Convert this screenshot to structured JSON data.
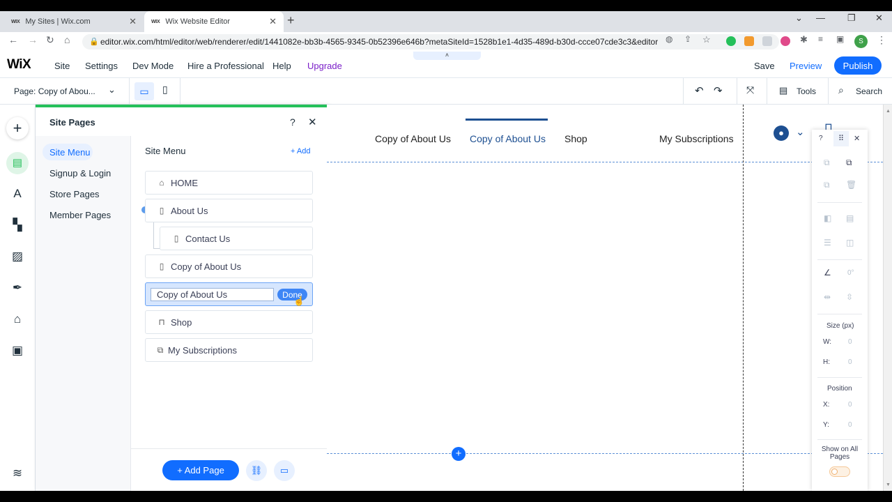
{
  "browser": {
    "tabs": [
      {
        "favicon": "WIX",
        "title": "My Sites | Wix.com"
      },
      {
        "favicon": "WIX",
        "title": "Wix Website Editor"
      }
    ],
    "url": "editor.wix.com/html/editor/web/renderer/edit/1441082e-bb3b-4565-9345-0b52396e646b?metaSiteId=1528b1e1-4d35-489d-b30d-ccce07cde3c3&editor...",
    "profile_initial": "S"
  },
  "topbar": {
    "logo": "WiX",
    "menu": [
      "Site",
      "Settings",
      "Dev Mode",
      "Hire a Professional",
      "Help",
      "Upgrade"
    ],
    "save": "Save",
    "preview": "Preview",
    "publish": "Publish",
    "collapse": "˄"
  },
  "toolbar": {
    "page_selector": "Page: Copy of Abou...",
    "tools": "Tools",
    "search": "Search"
  },
  "panel": {
    "title": "Site Pages",
    "help": "?",
    "categories": [
      "Site Menu",
      "Signup & Login",
      "Store Pages",
      "Member Pages"
    ],
    "section_title": "Site Menu",
    "add_label": "+ Add",
    "pages": [
      "HOME",
      "About Us",
      "Contact Us",
      "Copy of About Us",
      "Shop",
      "My Subscriptions"
    ],
    "rename_value": "Copy of About Us",
    "done_label": "Done",
    "add_page_label": "+ Add Page"
  },
  "canvas": {
    "nav": [
      "Copy of About Us",
      "Copy of About Us",
      "Shop",
      "My Subscriptions"
    ],
    "add_section": "+"
  },
  "inspector": {
    "help": "?",
    "angle": "0°",
    "size_label": "Size (px)",
    "w_label": "W:",
    "w_value": "0",
    "h_label": "H:",
    "h_value": "0",
    "position_label": "Position",
    "x_label": "X:",
    "x_value": "0",
    "y_label": "Y:",
    "y_value": "0",
    "show_all_pages": "Show on All Pages"
  },
  "colors": {
    "accent": "#116dff",
    "green_strip": "#25c05a",
    "upgrade": "#7a1ec8"
  }
}
